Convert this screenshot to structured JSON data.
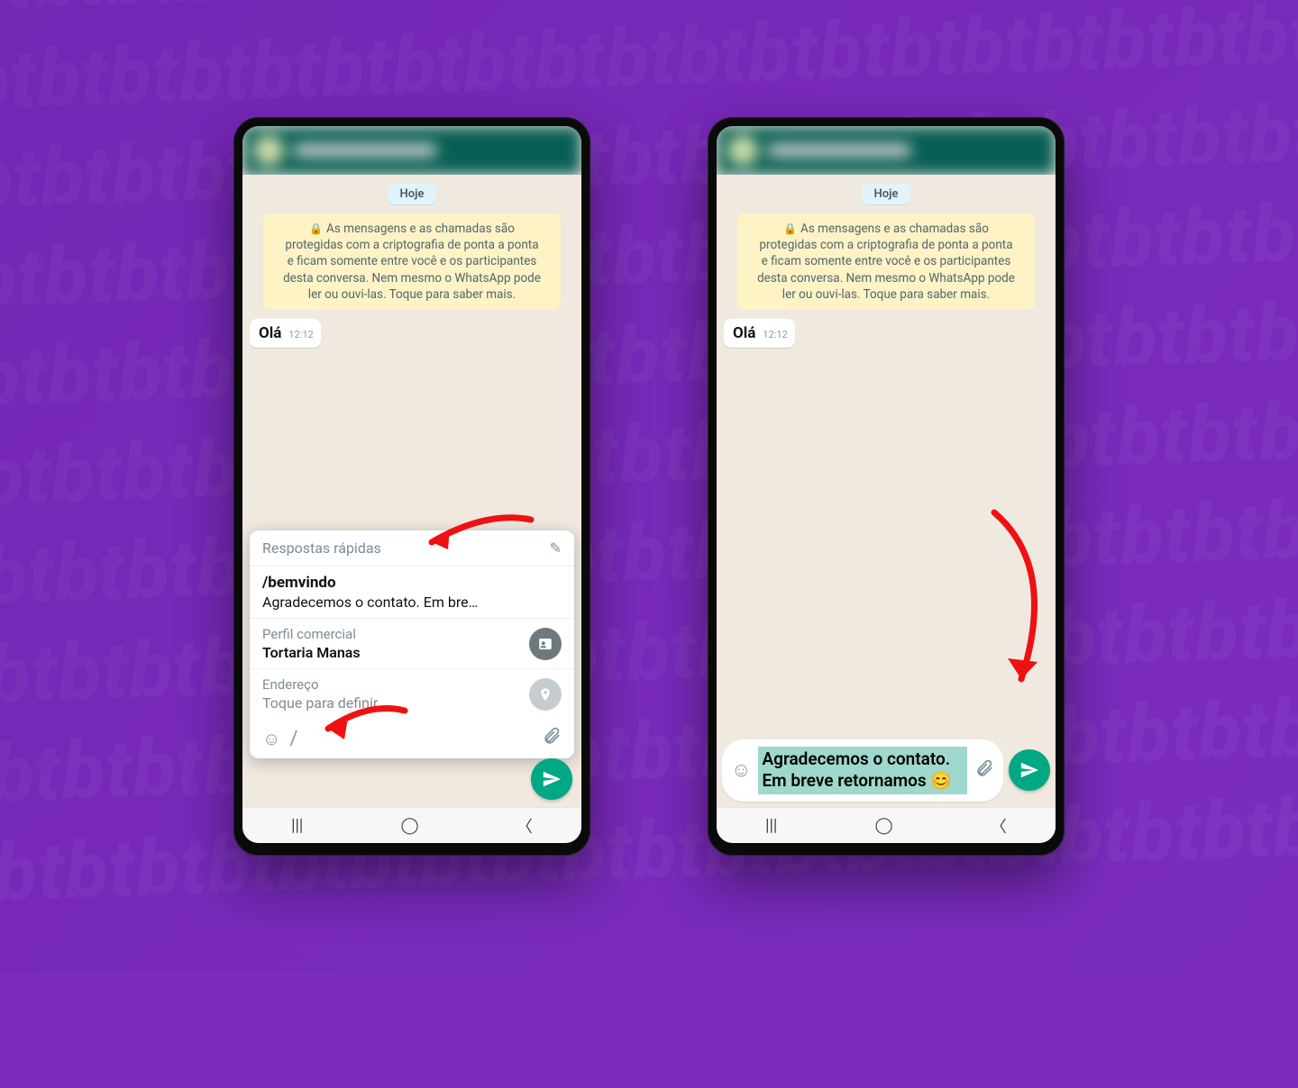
{
  "phone1": {
    "date_chip": "Hoje",
    "encryption": "As mensagens e as chamadas são protegidas com a criptografia de ponta a ponta e ficam somente entre você e os participantes desta conversa. Nem mesmo o WhatsApp pode ler ou ouvi-las. Toque para saber mais.",
    "msg_text": "Olá",
    "msg_time": "12:12",
    "quick_replies": {
      "header": "Respostas rápidas",
      "reply_cmd": "/bemvindo",
      "reply_preview": "Agradecemos o contato. Em bre…",
      "biz_profile_label": "Perfil comercial",
      "biz_profile_value": "Tortaria Manas",
      "address_label": "Endereço",
      "address_value": "Toque para definir",
      "slash_input": "/"
    }
  },
  "phone2": {
    "date_chip": "Hoje",
    "encryption": "As mensagens e as chamadas são protegidas com a criptografia de ponta a ponta e ficam somente entre você e os participantes desta conversa. Nem mesmo o WhatsApp pode ler ou ouvi-las. Toque para saber mais.",
    "msg_text": "Olá",
    "msg_time": "12:12",
    "draft": "Agradecemos o contato. Em breve retornamos 😊"
  }
}
